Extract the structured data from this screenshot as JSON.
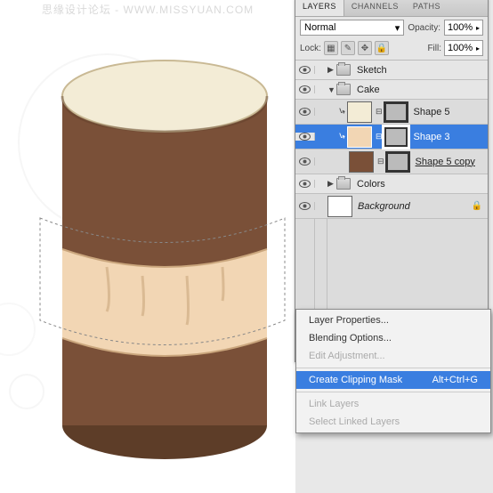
{
  "watermark": "思缘设计论坛 - WWW.MISSYUAN.COM",
  "panel": {
    "tabs": {
      "layers": "LAYERS",
      "channels": "CHANNELS",
      "paths": "PATHS"
    },
    "blend_mode": "Normal",
    "opacity_label": "Opacity:",
    "opacity_val": "100%",
    "lock_label": "Lock:",
    "fill_label": "Fill:",
    "fill_val": "100%"
  },
  "groups": {
    "sketch": "Sketch",
    "cake": "Cake",
    "colors": "Colors"
  },
  "layers": {
    "shape5": "Shape 5",
    "shape3": "Shape 3",
    "shape5copy": "Shape 5 copy",
    "background": "Background"
  },
  "menu": {
    "layer_props": "Layer Properties...",
    "blending": "Blending Options...",
    "edit_adj": "Edit Adjustment...",
    "create_clip": "Create Clipping Mask",
    "create_clip_sc": "Alt+Ctrl+G",
    "link": "Link Layers",
    "select_linked": "Select Linked Layers"
  },
  "thumbs": {
    "shape5_bg": "#f3ecd6",
    "shape3_bg": "#f2d6b4",
    "shape5c_bg": "#7a5038",
    "bg_bg": "#ffffff"
  }
}
